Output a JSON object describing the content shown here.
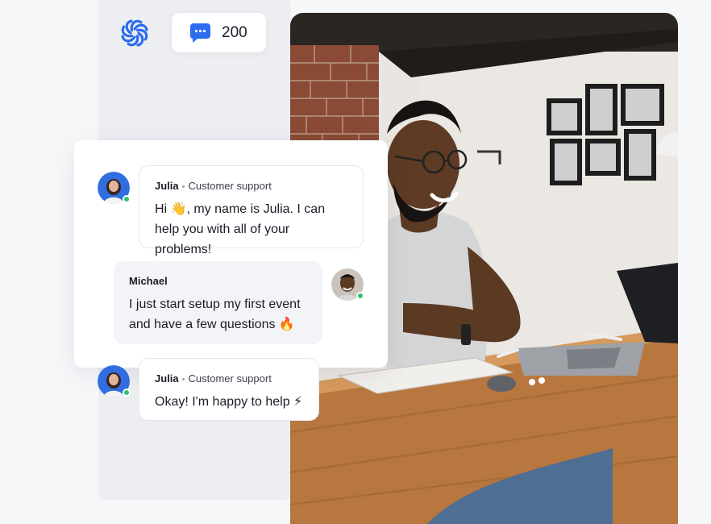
{
  "header": {
    "logo_icon": "spiral-logo-icon",
    "message_counter": {
      "icon": "chat-bubble-icon",
      "value": "200"
    }
  },
  "photo": {
    "description_icon": "man-at-laptop-photo"
  },
  "chat": {
    "messages": [
      {
        "sender": "Julia",
        "role": "Customer support",
        "text_before_emoji": "Hi ",
        "emoji": "👋",
        "text_after_emoji": ", my name is Julia. I can help you with all of your problems!",
        "online": true
      },
      {
        "sender": "Michael",
        "text": "I just start setup my first event and have a few questions ",
        "emoji": "🔥",
        "online": true
      },
      {
        "sender": "Julia",
        "role": "Customer support",
        "text": "Okay! I'm happy to help ",
        "emoji": "⚡",
        "online": true
      }
    ]
  },
  "colors": {
    "accent": "#2d6cf0",
    "online": "#2fc26a",
    "page_bg": "#f6f7f9",
    "panel_bg": "#eceef2"
  }
}
